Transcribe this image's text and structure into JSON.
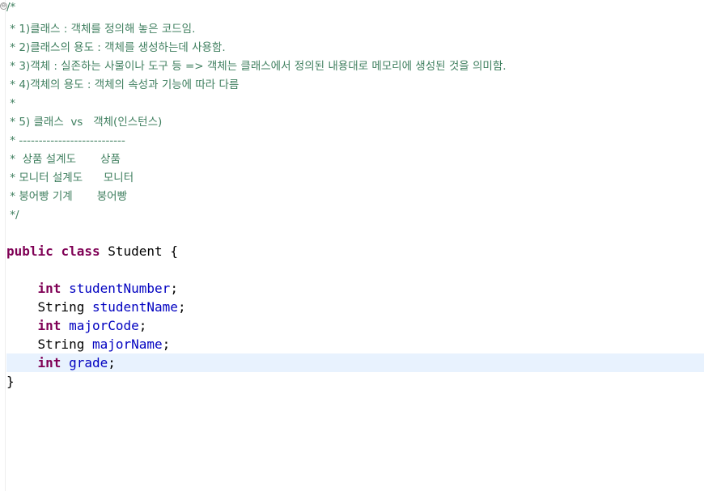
{
  "editor": {
    "fold_glyph": "⊖",
    "comment_lines": [
      "/*",
      " * 1)클래스 : 객체를 정의해 놓은 코드임.",
      " * 2)클래스의 용도 : 객체를 생성하는데 사용함.",
      " * 3)객체 : 실존하는 사물이나 도구 등 => 객체는 클래스에서 정의된 내용대로 메모리에 생성된 것을 의미함.",
      " * 4)객체의 용도 : 객체의 속성과 기능에 따라 다름",
      " *",
      " * 5) 클래스  vs   객체(인스턴스)",
      " * ---------------------------",
      " *  상품 설계도       상품",
      " * 모니터 설계도      모니터",
      " * 붕어빵 기계       붕어빵",
      " */"
    ],
    "code": {
      "class_decl": {
        "kw1": "public",
        "kw2": "class",
        "name": "Student",
        "brace": "{"
      },
      "fields": [
        {
          "type": "int",
          "type_is_keyword": true,
          "name": "studentNumber"
        },
        {
          "type": "String",
          "type_is_keyword": false,
          "name": "studentName"
        },
        {
          "type": "int",
          "type_is_keyword": true,
          "name": "majorCode"
        },
        {
          "type": "String",
          "type_is_keyword": false,
          "name": "majorName"
        },
        {
          "type": "int",
          "type_is_keyword": true,
          "name": "grade"
        }
      ],
      "close_brace": "}",
      "current_line_field_index": 4
    }
  }
}
